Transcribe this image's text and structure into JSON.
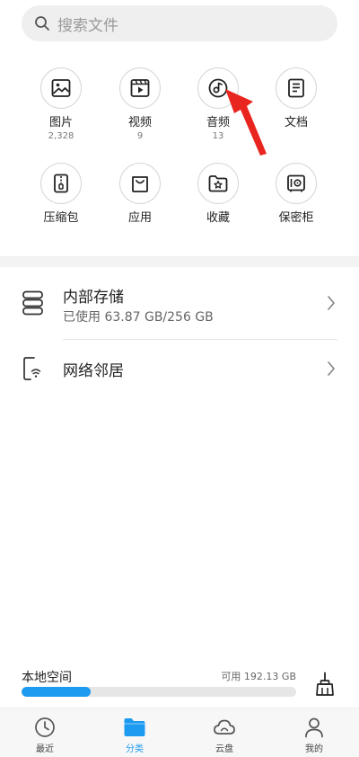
{
  "search": {
    "placeholder": "搜索文件"
  },
  "categories": [
    {
      "label": "图片",
      "count": "2,328",
      "icon": "image-icon"
    },
    {
      "label": "视频",
      "count": "9",
      "icon": "video-icon"
    },
    {
      "label": "音频",
      "count": "13",
      "icon": "audio-icon"
    },
    {
      "label": "文档",
      "count": "",
      "icon": "document-icon"
    },
    {
      "label": "压缩包",
      "count": "",
      "icon": "archive-icon"
    },
    {
      "label": "应用",
      "count": "",
      "icon": "app-bag-icon"
    },
    {
      "label": "收藏",
      "count": "",
      "icon": "favorite-folder-icon"
    },
    {
      "label": "保密柜",
      "count": "",
      "icon": "safe-icon"
    }
  ],
  "storage_rows": {
    "internal": {
      "title": "内部存储",
      "usage": "已使用 63.87 GB/256 GB"
    },
    "network": {
      "title": "网络邻居"
    }
  },
  "local_space": {
    "label": "本地空间",
    "available": "可用 192.13 GB",
    "used_fraction": 0.25
  },
  "nav": [
    {
      "label": "最近",
      "icon": "clock-icon"
    },
    {
      "label": "分类",
      "icon": "folder-icon",
      "active": true
    },
    {
      "label": "云盘",
      "icon": "cloud-icon"
    },
    {
      "label": "我的",
      "icon": "person-icon"
    }
  ],
  "colors": {
    "accent": "#1d9bf0",
    "annotation_arrow": "#e8261f"
  }
}
